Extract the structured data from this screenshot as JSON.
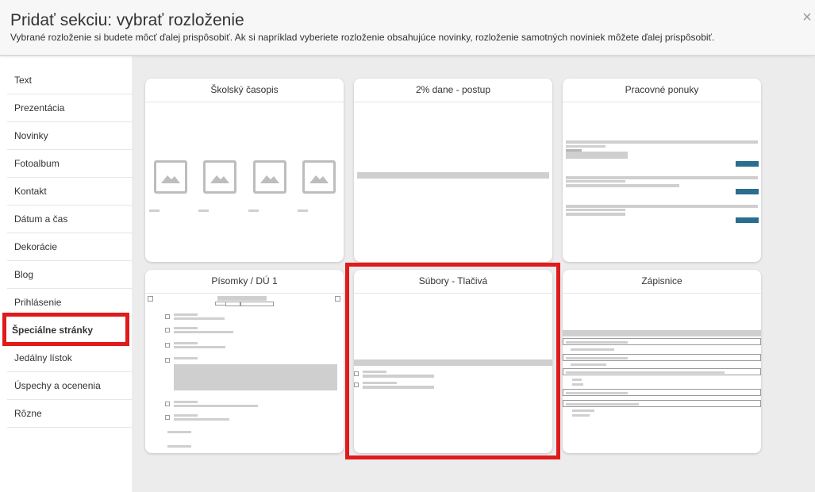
{
  "header": {
    "title": "Pridať sekciu: vybrať rozloženie",
    "subtitle": "Vybrané rozloženie si budete môcť ďalej prispôsobiť. Ak si napríklad vyberiete rozloženie obsahujúce novinky, rozloženie samotných noviniek môžete ďalej prispôsobiť.",
    "close_glyph": "×"
  },
  "sidebar": {
    "items": [
      {
        "label": "Text"
      },
      {
        "label": "Prezentácia"
      },
      {
        "label": "Novinky"
      },
      {
        "label": "Fotoalbum"
      },
      {
        "label": "Kontakt"
      },
      {
        "label": "Dátum a čas"
      },
      {
        "label": "Dekorácie"
      },
      {
        "label": "Blog"
      },
      {
        "label": "Prihlásenie"
      },
      {
        "label": "Špeciálne stránky"
      },
      {
        "label": "Jedálny lístok"
      },
      {
        "label": "Úspechy a ocenenia"
      },
      {
        "label": "Rôzne"
      }
    ],
    "selected_index": 9
  },
  "layouts": {
    "cards": [
      {
        "title": "Školský časopis"
      },
      {
        "title": "2% dane - postup"
      },
      {
        "title": "Pracovné ponuky"
      },
      {
        "title": "Písomky / DÚ 1"
      },
      {
        "title": "Súbory - Tlačivá"
      },
      {
        "title": "Zápisnice"
      }
    ],
    "selected_index": 4
  },
  "colors": {
    "selection": "#e01b1b",
    "button_blue": "#2a6d8e"
  },
  "icons": [
    "close-icon",
    "image-placeholder-icon"
  ]
}
